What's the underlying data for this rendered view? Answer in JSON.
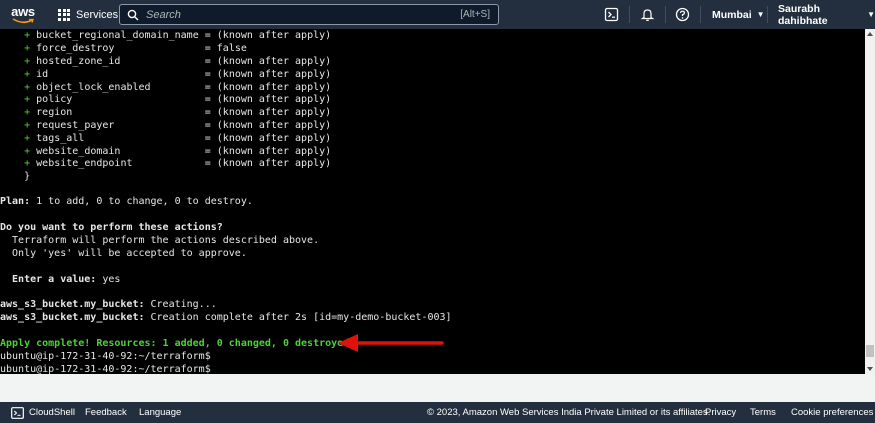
{
  "header": {
    "logo_text": "aws",
    "services_label": "Services",
    "search": {
      "placeholder": "Search",
      "shortcut": "[Alt+S]"
    },
    "icons": [
      "cloudshell-icon",
      "bell-icon",
      "help-icon"
    ],
    "region_label": "Mumbai",
    "user_label": "Saurabh dahibhate"
  },
  "terminal": {
    "attributes": [
      "bucket_regional_domain_name = (known after apply)",
      "force_destroy               = false",
      "hosted_zone_id              = (known after apply)",
      "id                          = (known after apply)",
      "object_lock_enabled         = (known after apply)",
      "policy                      = (known after apply)",
      "region                      = (known after apply)",
      "request_payer               = (known after apply)",
      "tags_all                    = (known after apply)",
      "website_domain              = (known after apply)",
      "website_endpoint            = (known after apply)"
    ],
    "close_brace": "}",
    "plan_label": "Plan:",
    "plan_text": " 1 to add, 0 to change, 0 to destroy.",
    "confirm_question": "Do you want to perform these actions?",
    "confirm_line1": "  Terraform will perform the actions described above.",
    "confirm_line2": "  Only 'yes' will be accepted to approve.",
    "enter_label": "  Enter a value:",
    "enter_value": " yes",
    "resource_name": "aws_s3_bucket.my_bucket:",
    "creating_text": " Creating...",
    "complete_text": " Creation complete after 2s [id=my-demo-bucket-003]",
    "apply_text": "Apply complete! Resources: 1 added, 0 changed, 0 destroyed.",
    "prompt1": "ubuntu@ip-172-31-40-92:~/terraform$",
    "prompt2": "ubuntu@ip-172-31-40-92:~/terraform$"
  },
  "footer": {
    "cloudshell_label": "CloudShell",
    "feedback_label": "Feedback",
    "language_label": "Language",
    "copyright": "© 2023, Amazon Web Services India Private Limited or its affiliates.",
    "privacy_label": "Privacy",
    "terms_label": "Terms",
    "cookie_label": "Cookie preferences"
  },
  "colors": {
    "nav_bg": "#232f3e",
    "terminal_bg": "#000000",
    "green": "#4cd137",
    "arrow": "#e0120c"
  }
}
